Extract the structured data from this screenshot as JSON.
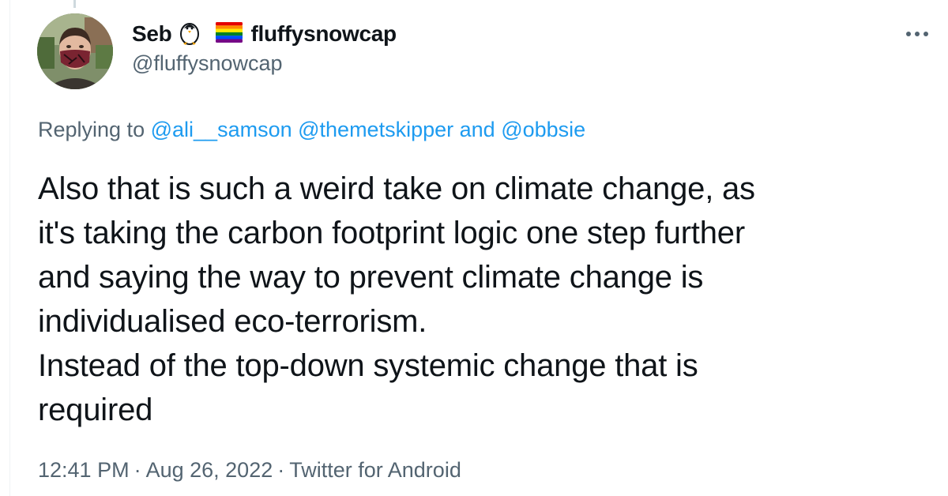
{
  "author": {
    "display_name_prefix": "Seb",
    "display_name_suffix": "fluffysnowcap",
    "handle": "@fluffysnowcap",
    "emojis": [
      "penguin-icon",
      "rainbow-flag-icon"
    ]
  },
  "reply": {
    "prefix": "Replying to",
    "mention_1": "@ali__samson",
    "mention_2": "@themetskipper",
    "connector": "and",
    "mention_3": "@obbsie"
  },
  "tweet": {
    "lines": [
      "Also that is such a weird take on climate change, as",
      "it's taking the carbon footprint logic one step further",
      "and saying the way to prevent climate change is",
      "individualised eco-terrorism.",
      "Instead of the top-down systemic change that is",
      "required"
    ]
  },
  "meta": {
    "time": "12:41 PM",
    "separator": "·",
    "date": "Aug 26, 2022",
    "source": "Twitter for Android"
  },
  "colors": {
    "link": "#1d9bf0",
    "secondary_text": "#536471",
    "primary_text": "#0f1419"
  }
}
